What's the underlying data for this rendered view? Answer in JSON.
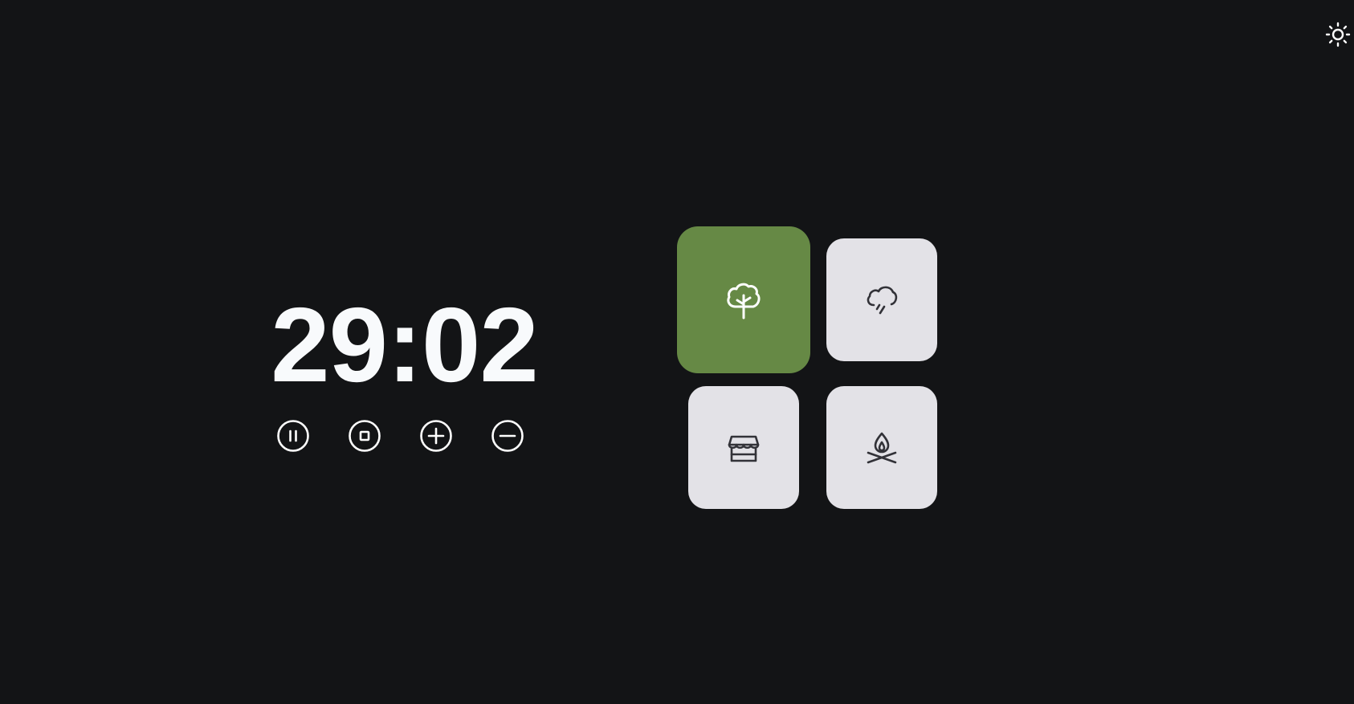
{
  "theme_toggle": {
    "icon": "sun-icon"
  },
  "timer": {
    "display": "29:02"
  },
  "controls": [
    {
      "name": "pause",
      "icon": "pause-circle-icon"
    },
    {
      "name": "stop",
      "icon": "stop-circle-icon"
    },
    {
      "name": "increase",
      "icon": "plus-circle-icon"
    },
    {
      "name": "decrease",
      "icon": "minus-circle-icon"
    }
  ],
  "sounds": [
    {
      "name": "forest",
      "icon": "tree-icon",
      "active": true
    },
    {
      "name": "rain",
      "icon": "cloud-rain-icon",
      "active": false
    },
    {
      "name": "cafe",
      "icon": "storefront-icon",
      "active": false
    },
    {
      "name": "campfire",
      "icon": "campfire-icon",
      "active": false
    }
  ],
  "colors": {
    "background": "#131416",
    "active_tile": "#668945",
    "inactive_tile": "#e3e2e7",
    "icon_dark": "#323238",
    "text": "#f8fafc"
  }
}
